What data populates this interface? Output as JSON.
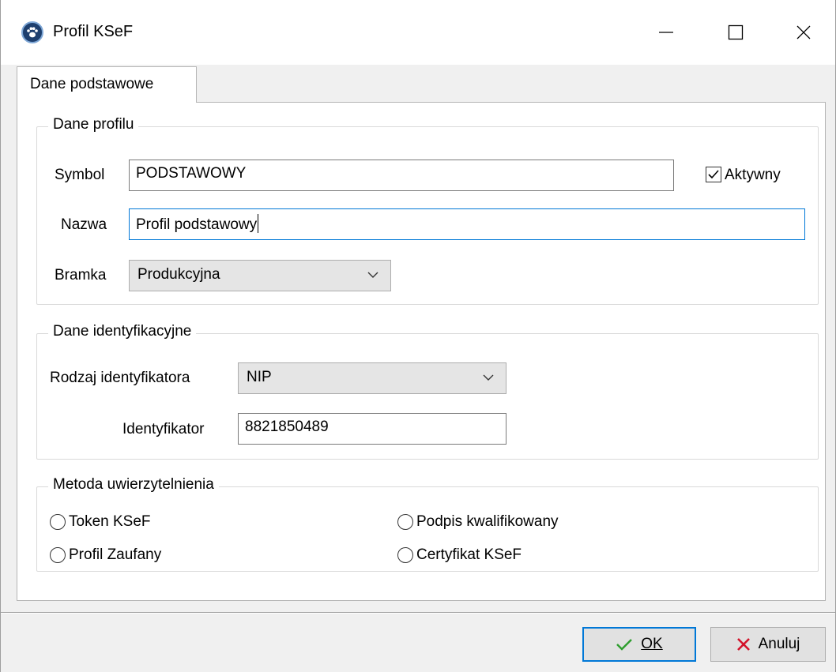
{
  "window": {
    "title": "Profil KSeF",
    "icon": "paw-icon"
  },
  "tabs": [
    {
      "label": "Dane podstawowe",
      "active": true
    }
  ],
  "profile_group": {
    "legend": "Dane profilu",
    "symbol_label": "Symbol",
    "symbol_value": "PODSTAWOWY",
    "active_label": "Aktywny",
    "active_checked": true,
    "name_label": "Nazwa",
    "name_value": "Profil podstawowy",
    "gateway_label": "Bramka",
    "gateway_value": "Produkcyjna"
  },
  "identification_group": {
    "legend": "Dane identyfikacyjne",
    "id_type_label": "Rodzaj identyfikatora",
    "id_type_value": "NIP",
    "id_label": "Identyfikator",
    "id_value": "8821850489"
  },
  "auth_group": {
    "legend": "Metoda uwierzytelnienia",
    "options": [
      {
        "label": "Token KSeF",
        "selected": false
      },
      {
        "label": "Podpis kwalifikowany",
        "selected": false
      },
      {
        "label": "Profil Zaufany",
        "selected": false
      },
      {
        "label": "Certyfikat KSeF",
        "selected": false
      }
    ]
  },
  "buttons": {
    "ok_label": "OK",
    "cancel_label": "Anuluj"
  },
  "colors": {
    "focus": "#0078d7",
    "ok_check": "#2e9e2e",
    "cancel_x": "#d3122a"
  }
}
